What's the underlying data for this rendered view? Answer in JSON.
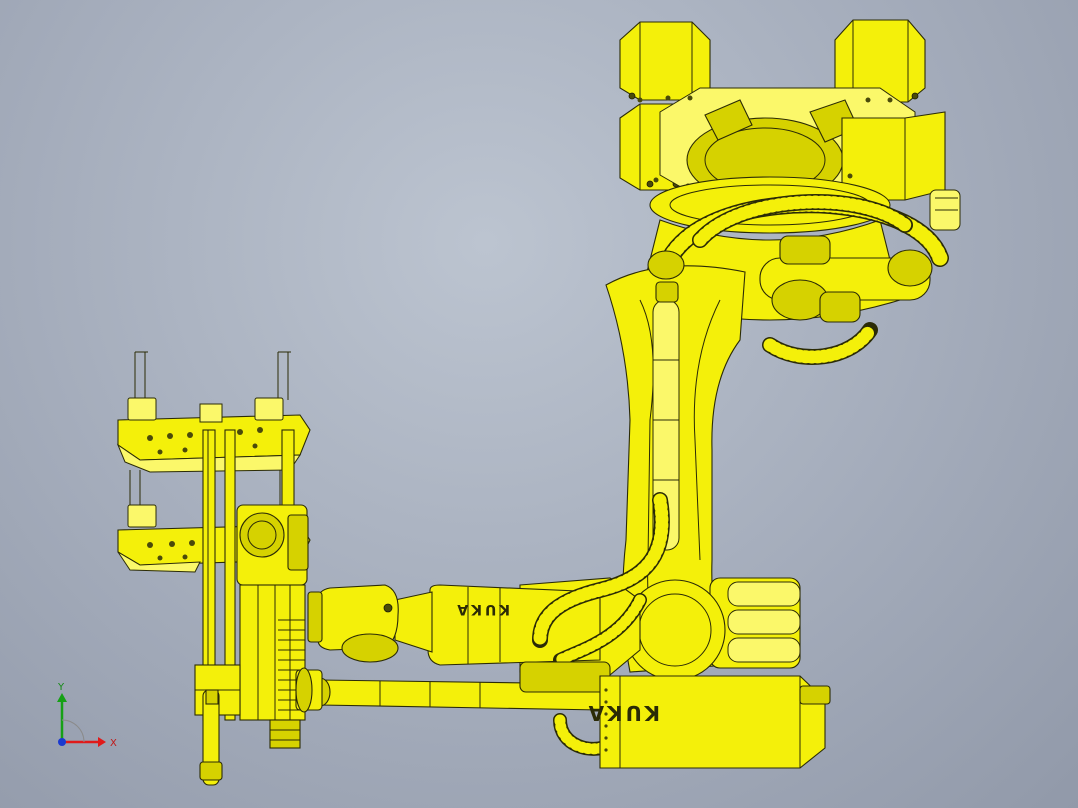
{
  "branding": {
    "arm_label": "KUKA",
    "motor_label": "KUKA"
  },
  "triad": {
    "x_label": "X",
    "y_label": "Y",
    "x_color": "#e01a1a",
    "y_color": "#16a016",
    "z_color": "#1a3ad0"
  },
  "colors": {
    "background": "#a4acbb",
    "robot_yellow": "#f4f00a",
    "outline": "#2b2b06"
  }
}
